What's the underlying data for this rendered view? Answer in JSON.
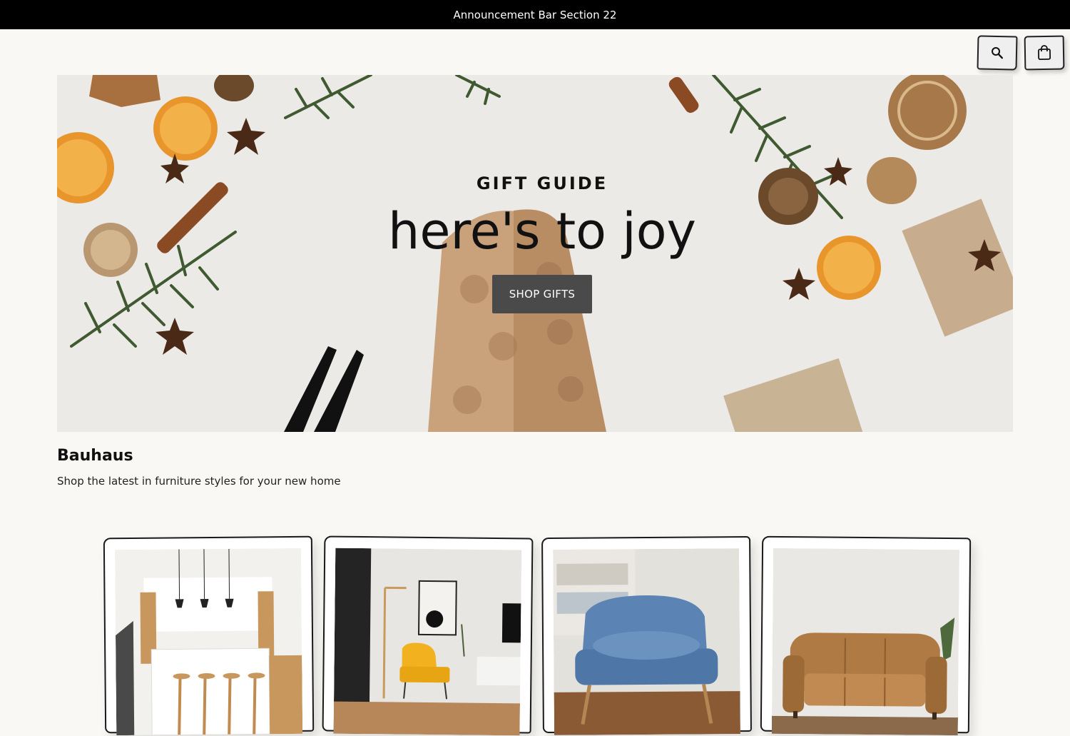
{
  "announcement": {
    "text": "Announcement Bar Section 22"
  },
  "header": {
    "icons": [
      "search-icon",
      "shopping-bag-icon"
    ]
  },
  "hero": {
    "subtitle": "GIFT GUIDE",
    "title": "here's to joy",
    "button_label": "SHOP GIFTS"
  },
  "collection": {
    "title": "Bauhaus",
    "description": "Shop the latest in furniture styles for your new home",
    "products": [
      {
        "image": "kitchen-photo"
      },
      {
        "image": "yellow-armchair-photo"
      },
      {
        "image": "blue-armchair-photo"
      },
      {
        "image": "leather-sofa-photo"
      }
    ]
  },
  "colors": {
    "announcement_bg": "#000000",
    "page_bg": "#f9f8f5",
    "button_bg": "#4a4a4a"
  }
}
